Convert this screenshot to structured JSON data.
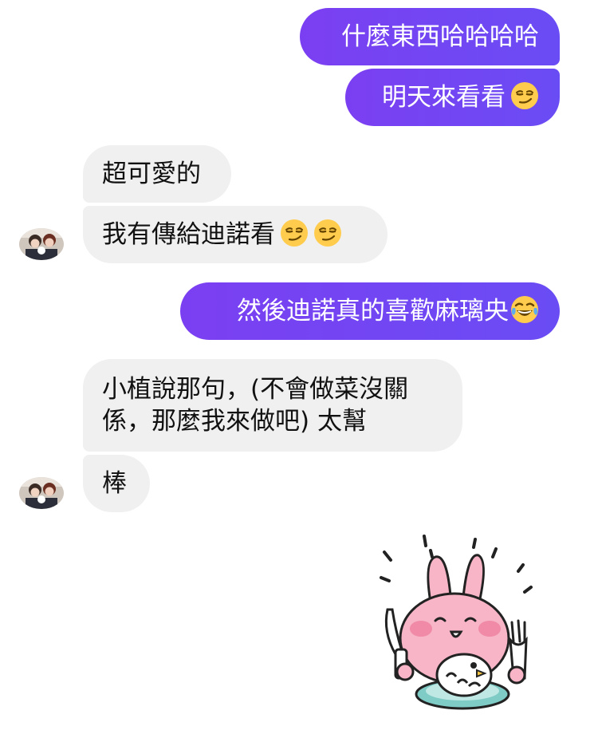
{
  "conversation": {
    "messages": [
      {
        "id": "m1",
        "direction": "outgoing",
        "text": "什麼東西哈哈哈哈",
        "emojis": []
      },
      {
        "id": "m2",
        "direction": "outgoing",
        "text": "明天來看看",
        "emojis": [
          "smirking-face"
        ]
      },
      {
        "id": "m3",
        "direction": "incoming",
        "text": "超可愛的",
        "emojis": []
      },
      {
        "id": "m4",
        "direction": "incoming",
        "text": "我有傳給迪諾看",
        "emojis": [
          "smirking-face",
          "smirking-face"
        ]
      },
      {
        "id": "m5",
        "direction": "outgoing",
        "text": "然後迪諾真的喜歡麻璃央",
        "emojis": [
          "face-with-tears-of-joy"
        ]
      },
      {
        "id": "m6",
        "direction": "incoming",
        "text_line1": "小植說那句，(不會做菜沒關",
        "text_line2": "係，那麼我來做吧) 太幫"
      },
      {
        "id": "m7",
        "direction": "incoming",
        "text": "棒",
        "emojis": []
      },
      {
        "id": "m8",
        "direction": "outgoing",
        "type": "sticker",
        "sticker": "pink-rabbit-with-knife-fork-sticker"
      }
    ]
  },
  "colors": {
    "outgoing_start": "#7b3ff2",
    "outgoing_end": "#6a4cf4",
    "incoming_bg": "#f0f0f0",
    "incoming_text": "#111111",
    "outgoing_text": "#ffffff"
  }
}
